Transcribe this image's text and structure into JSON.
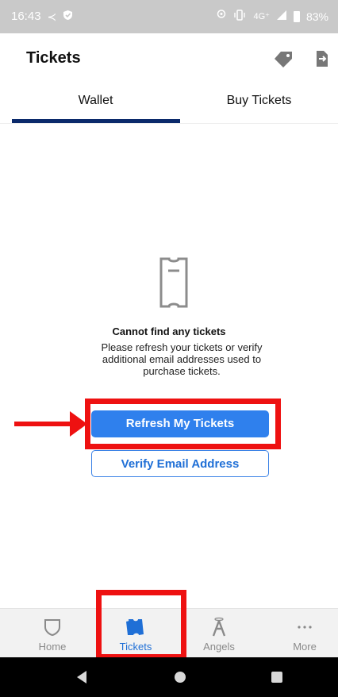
{
  "status_bar": {
    "time": "16:43",
    "network": "4G⁺",
    "battery": "83%"
  },
  "header": {
    "title": "Tickets",
    "icons": [
      "tag-icon",
      "transfer-icon"
    ]
  },
  "tabs": [
    {
      "label": "Wallet",
      "selected": true
    },
    {
      "label": "Buy Tickets",
      "selected": false
    }
  ],
  "empty_state": {
    "icon": "ticket-outline-icon",
    "title": "Cannot find any tickets",
    "message": "Please refresh your tickets or verify additional email addresses used to purchase tickets."
  },
  "buttons": {
    "refresh_label": "Refresh My Tickets",
    "verify_label": "Verify Email Address"
  },
  "bottom_nav": [
    {
      "label": "Home",
      "icon": "shield-outline-icon",
      "active": false
    },
    {
      "label": "Tickets",
      "icon": "tickets-icon",
      "active": true
    },
    {
      "label": "Angels",
      "icon": "angels-logo-icon",
      "active": false
    },
    {
      "label": "More",
      "icon": "more-dots-icon",
      "active": false
    }
  ],
  "colors": {
    "accent": "#2f80ed",
    "tab_indicator": "#0b2a6b",
    "annotation": "#ee1111"
  }
}
